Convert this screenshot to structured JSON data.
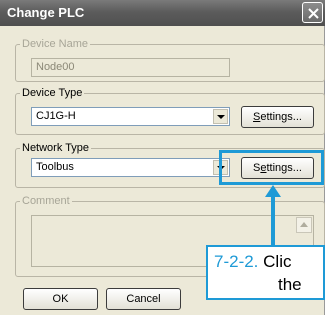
{
  "window": {
    "title": "Change PLC"
  },
  "device_name": {
    "legend": "Device Name",
    "value": "Node00"
  },
  "device_type": {
    "legend": "Device Type",
    "value": "CJ1G-H",
    "settings_label": "Settings...",
    "settings_mnemonic": "S",
    "settings_rest": "ettings..."
  },
  "network_type": {
    "legend": "Network Type",
    "value": "Toolbus",
    "settings_label": "Settings...",
    "settings_pre": "S",
    "settings_mnemonic": "e",
    "settings_rest": "ttings..."
  },
  "comment": {
    "legend": "Comment"
  },
  "footer": {
    "ok_label": "OK",
    "cancel_label": "Cancel"
  },
  "callout": {
    "step": "7-2-2.",
    "line1_text": "Clic",
    "line2_text": "the"
  },
  "colors": {
    "highlight": "#1e9ad6",
    "titlebar": "#5c5c5c",
    "dialog_bg": "#ece9d8"
  },
  "icons": {
    "close": "close-icon",
    "dropdown": "chevron-down-icon",
    "scroll_up": "scroll-up-icon",
    "arrow": "arrow-up-icon"
  }
}
